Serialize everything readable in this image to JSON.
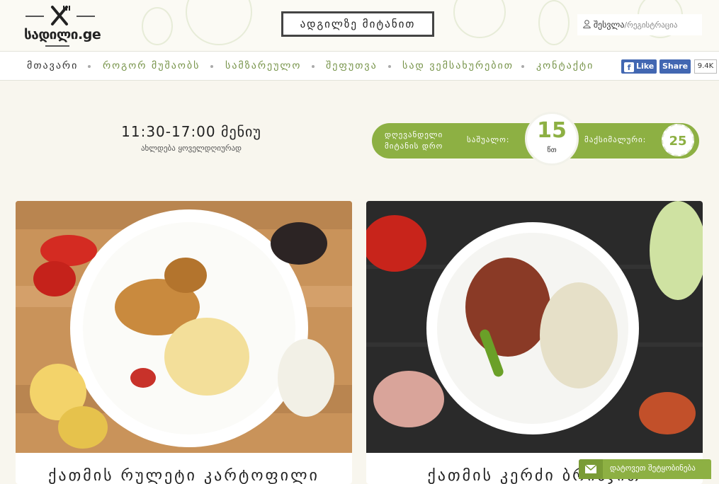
{
  "header": {
    "logo_text": "სადილი.ge",
    "order_button": "ადგილზე მიტანით",
    "login_label": "შესვლა",
    "register_label": "/რეგისტრაცია"
  },
  "nav": {
    "items": [
      {
        "label": "მთავარი"
      },
      {
        "label": "როგორ მუშაობს"
      },
      {
        "label": "სამზარეულო"
      },
      {
        "label": "შეფუთვა"
      },
      {
        "label": "სად ვემსახურებით"
      },
      {
        "label": "კონტაქტი"
      }
    ],
    "fb_like": "Like",
    "fb_share": "Share",
    "fb_count": "9.4K"
  },
  "info": {
    "hours": "11:30-17:00 მენიუ",
    "hours_sub": "ახლდება ყოველდღიურად",
    "delivery_label": "დღევანდელი მიტანის დრო",
    "average_label": "საშუალო:",
    "average_value": "15",
    "average_unit": "წთ",
    "max_label": "მაქსიმალური:",
    "max_value": "25"
  },
  "cards": [
    {
      "title": "ქათმის რულეტი კარტოფილი"
    },
    {
      "title": "ქათმის კერძი ბრინჯით"
    }
  ],
  "contact": {
    "label": "დატოვეთ შეტყობინება"
  },
  "colors": {
    "accent": "#8db043",
    "facebook": "#4267b2"
  }
}
